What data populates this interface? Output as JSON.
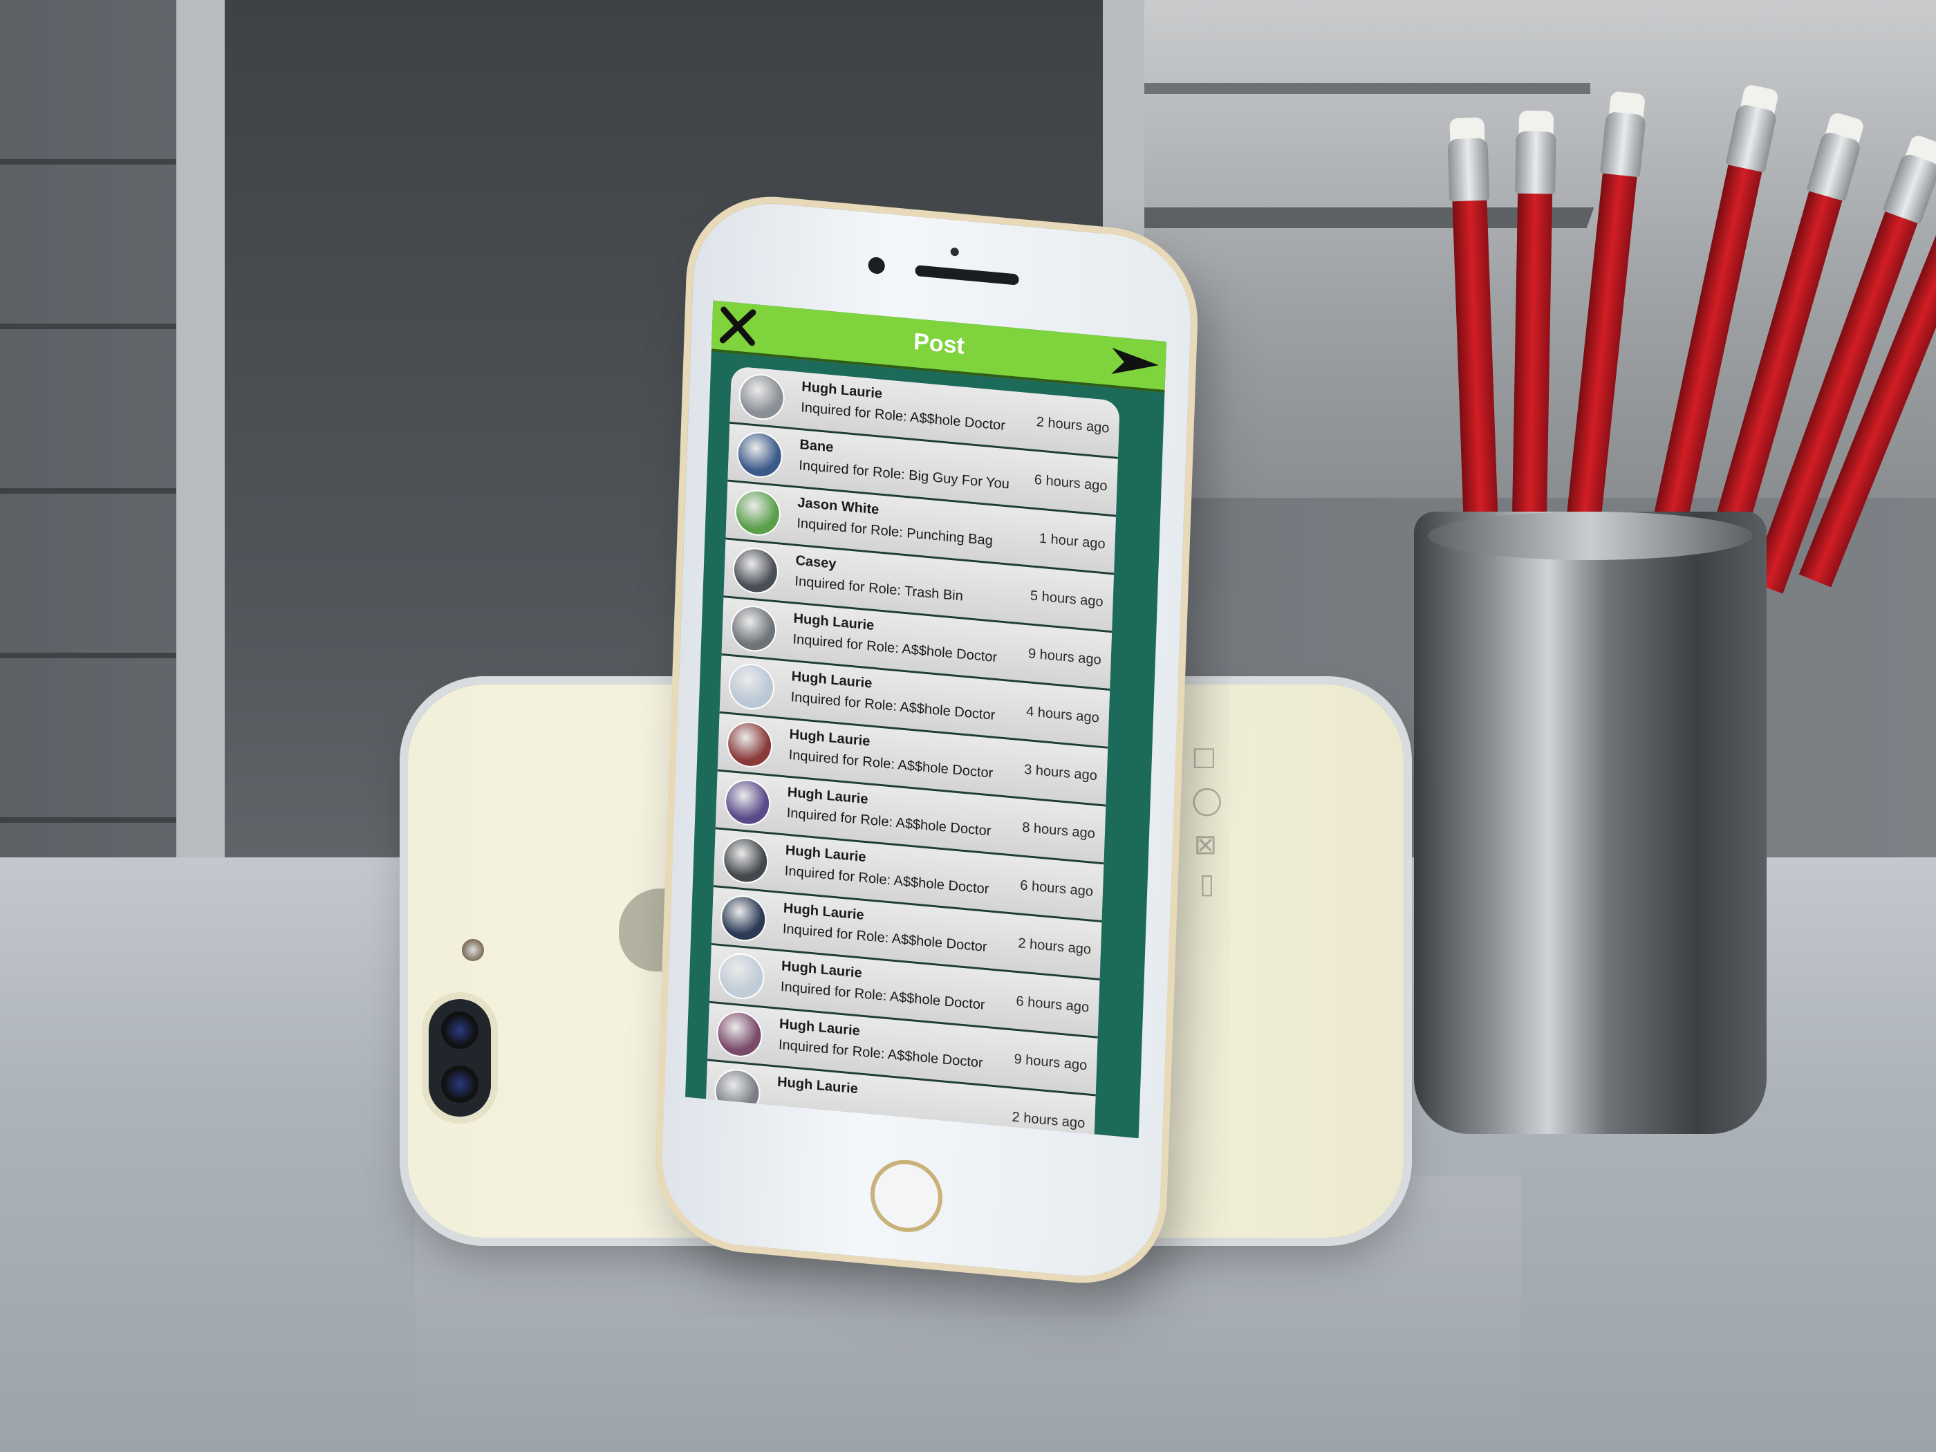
{
  "app": {
    "title": "Post",
    "close_icon": "close-icon",
    "send_icon": "send-icon"
  },
  "colors": {
    "header": "#7fd33c",
    "background": "#1c6a59",
    "list": "#d6d6d6"
  },
  "feed": [
    {
      "name": "Hugh Laurie",
      "role": "Inquired for Role: A$$hole Doctor",
      "time": "2 hours ago",
      "avatar": "#8a8f95"
    },
    {
      "name": "Bane",
      "role": "Inquired for Role: Big Guy For You",
      "time": "6 hours ago",
      "avatar": "#3a5a8a"
    },
    {
      "name": "Jason White",
      "role": "Inquired for Role: Punching Bag",
      "time": "1 hour ago",
      "avatar": "#5aa04a"
    },
    {
      "name": "Casey",
      "role": "Inquired for Role: Trash Bin",
      "time": "5 hours ago",
      "avatar": "#4a4e55"
    },
    {
      "name": "Hugh Laurie",
      "role": "Inquired for Role: A$$hole Doctor",
      "time": "9 hours ago",
      "avatar": "#6e7378"
    },
    {
      "name": "Hugh Laurie",
      "role": "Inquired for Role: A$$hole Doctor",
      "time": "4 hours ago",
      "avatar": "#b9c7d6"
    },
    {
      "name": "Hugh Laurie",
      "role": "Inquired for Role: A$$hole Doctor",
      "time": "3 hours ago",
      "avatar": "#8a3a3a"
    },
    {
      "name": "Hugh Laurie",
      "role": "Inquired for Role: A$$hole Doctor",
      "time": "8 hours ago",
      "avatar": "#5a4a8a"
    },
    {
      "name": "Hugh Laurie",
      "role": "Inquired for Role: A$$hole Doctor",
      "time": "6 hours ago",
      "avatar": "#44484d"
    },
    {
      "name": "Hugh Laurie",
      "role": "Inquired for Role: A$$hole Doctor",
      "time": "2 hours ago",
      "avatar": "#2a3a55"
    },
    {
      "name": "Hugh Laurie",
      "role": "Inquired for Role: A$$hole Doctor",
      "time": "6 hours ago",
      "avatar": "#c0ccd8"
    },
    {
      "name": "Hugh Laurie",
      "role": "Inquired for Role: A$$hole Doctor",
      "time": "9 hours ago",
      "avatar": "#7a4a6a"
    },
    {
      "name": "Hugh Laurie",
      "role": "",
      "time": "2 hours ago",
      "avatar": "#7a7e84"
    }
  ]
}
